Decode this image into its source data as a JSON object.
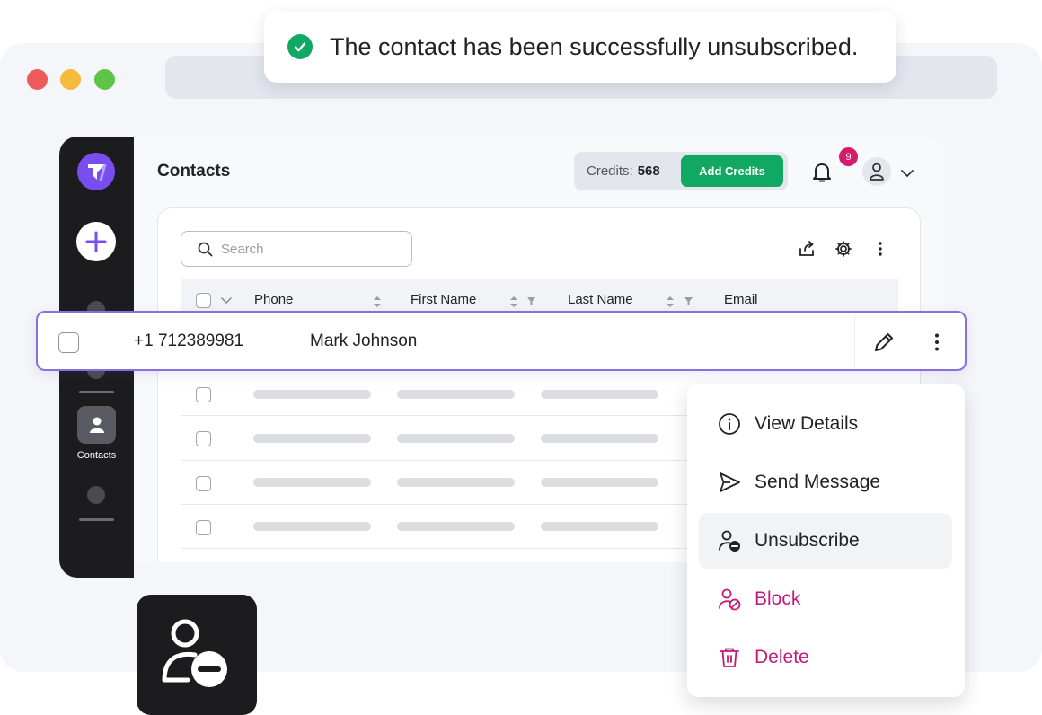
{
  "toast": {
    "message": "The contact has been successfully unsubscribed.",
    "icon": "check-circle-icon",
    "color": "#11a863"
  },
  "sidebar": {
    "active_label": "Contacts"
  },
  "header": {
    "title": "Contacts",
    "credits_label": "Credits:",
    "credits_value": "568",
    "add_credits": "Add Credits",
    "notification_count": "9"
  },
  "search": {
    "placeholder": "Search"
  },
  "table": {
    "columns": [
      "Phone",
      "First Name",
      "Last Name",
      "Email"
    ]
  },
  "selected_row": {
    "phone": "+1 712389981",
    "name": "Mark Johnson"
  },
  "context_menu": {
    "items": [
      {
        "label": "View Details",
        "icon": "info-icon"
      },
      {
        "label": "Send Message",
        "icon": "send-icon"
      },
      {
        "label": "Unsubscribe",
        "icon": "user-minus-icon"
      },
      {
        "label": "Block",
        "icon": "user-block-icon"
      },
      {
        "label": "Delete",
        "icon": "trash-icon"
      }
    ]
  },
  "colors": {
    "accent": "#7a4df0",
    "success": "#10a862",
    "danger": "#c41a78",
    "badge": "#d61a6c"
  }
}
